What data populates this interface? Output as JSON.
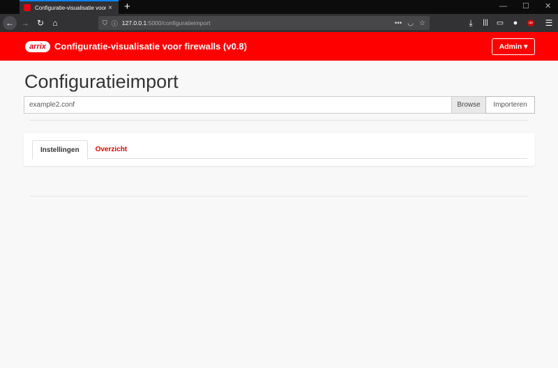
{
  "browser": {
    "tab_title": "Configuratie-visualisatie voor firewalls",
    "tab_close": "×",
    "new_tab": "+",
    "url_host": "127.0.0.1",
    "url_rest": ":5000/configuratieimport"
  },
  "header": {
    "logo_text": "arrix",
    "title": "Configuratie-visualisatie voor firewalls (v0.8)",
    "admin_label": "Admin ▾"
  },
  "page": {
    "title": "Configuratieimport",
    "file_value": "example2.conf",
    "browse_label": "Browse",
    "import_label": "Importeren"
  },
  "tabs": [
    {
      "label": "Instellingen",
      "active": true
    },
    {
      "label": "Overzicht",
      "active": false
    }
  ],
  "colors": {
    "brand": "#ff0000",
    "link": "#e00000"
  }
}
